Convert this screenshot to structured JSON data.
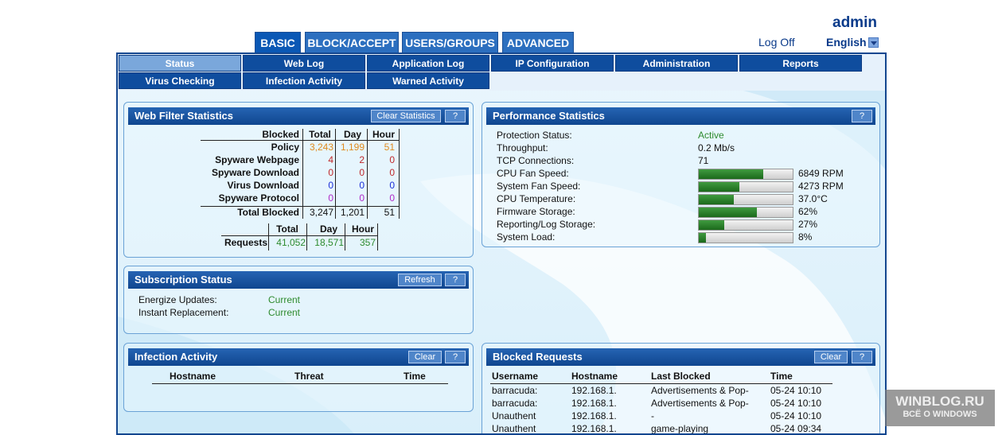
{
  "header": {
    "user": "admin",
    "logoff": "Log Off",
    "language": "English"
  },
  "top_tabs": [
    "BASIC",
    "BLOCK/ACCEPT",
    "USERS/GROUPS",
    "ADVANCED"
  ],
  "sub_tabs": [
    "Status",
    "Web Log",
    "Application Log",
    "IP Configuration",
    "Administration",
    "Reports",
    "Virus Checking",
    "Infection Activity",
    "Warned Activity"
  ],
  "web_filter": {
    "title": "Web Filter Statistics",
    "clear_btn": "Clear Statistics",
    "help_btn": "?",
    "headers": [
      "Blocked",
      "Total",
      "Day",
      "Hour"
    ],
    "rows": [
      {
        "label": "Policy",
        "total": "3,243",
        "day": "1,199",
        "hour": "51",
        "color": "#e08a1e"
      },
      {
        "label": "Spyware Webpage",
        "total": "4",
        "day": "2",
        "hour": "0",
        "color": "#c0282a"
      },
      {
        "label": "Spyware Download",
        "total": "0",
        "day": "0",
        "hour": "0",
        "color": "#c0282a"
      },
      {
        "label": "Virus Download",
        "total": "0",
        "day": "0",
        "hour": "0",
        "color": "#1c2ed8"
      },
      {
        "label": "Spyware Protocol",
        "total": "0",
        "day": "0",
        "hour": "0",
        "color": "#b02ac8"
      }
    ],
    "total_label": "Total Blocked",
    "total": {
      "total": "3,247",
      "day": "1,201",
      "hour": "51"
    },
    "req_headers": [
      "Total",
      "Day",
      "Hour"
    ],
    "req_label": "Requests",
    "requests": {
      "total": "41,052",
      "day": "18,571",
      "hour": "357"
    }
  },
  "performance": {
    "title": "Performance Statistics",
    "help_btn": "?",
    "rows": [
      {
        "label": "Protection Status:",
        "value": "Active",
        "accent": "#2e8b2e"
      },
      {
        "label": "Throughput:",
        "value": "0.2 Mb/s"
      },
      {
        "label": "TCP Connections:",
        "value": "71"
      },
      {
        "label": "CPU Fan Speed:",
        "value": "6849 RPM",
        "level": 0.69
      },
      {
        "label": "System Fan Speed:",
        "value": "4273 RPM",
        "level": 0.43
      },
      {
        "label": "CPU Temperature:",
        "value": "37.0°C",
        "level": 0.37
      },
      {
        "label": "Firmware Storage:",
        "value": "62%",
        "level": 0.62
      },
      {
        "label": "Reporting/Log Storage:",
        "value": "27%",
        "level": 0.27
      },
      {
        "label": "System Load:",
        "value": "8%",
        "level": 0.08
      }
    ]
  },
  "subscription": {
    "title": "Subscription Status",
    "refresh_btn": "Refresh",
    "help_btn": "?",
    "rows": [
      {
        "label": "Energize Updates:",
        "value": "Current"
      },
      {
        "label": "Instant Replacement:",
        "value": "Current"
      }
    ]
  },
  "infection": {
    "title": "Infection Activity",
    "clear_btn": "Clear",
    "help_btn": "?",
    "headers": [
      "Hostname",
      "Threat",
      "Time"
    ]
  },
  "blocked": {
    "title": "Blocked Requests",
    "clear_btn": "Clear",
    "help_btn": "?",
    "headers": [
      "Username",
      "Hostname",
      "Last Blocked",
      "Time"
    ],
    "rows": [
      {
        "user": "barracuda:",
        "host": "192.168.1.",
        "last": "Advertisements & Pop-",
        "time": "05-24 10:10"
      },
      {
        "user": "barracuda:",
        "host": "192.168.1.",
        "last": "Advertisements & Pop-",
        "time": "05-24 10:10"
      },
      {
        "user": "Unauthent",
        "host": "192.168.1.",
        "last": "-",
        "time": "05-24 10:10"
      },
      {
        "user": "Unauthent",
        "host": "192.168.1.",
        "last": "game-playing",
        "time": "05-24 09:34"
      }
    ]
  },
  "watermark": {
    "line1": "WINBLOG.RU",
    "line2": "ВСЁ О WINDOWS"
  },
  "colors": {
    "green": "#2e8b2e",
    "navy": "#0f4d9e"
  }
}
